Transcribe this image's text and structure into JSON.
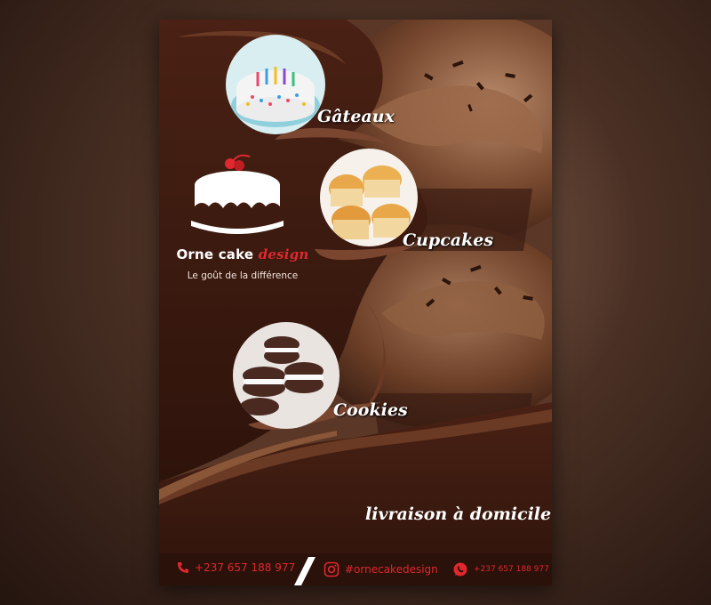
{
  "brand": {
    "name_part1": "Orne cake",
    "name_part2": "design",
    "tagline": "Le goût de la différence"
  },
  "sections": [
    {
      "label": "Gâteaux",
      "icon": "birthday-cake-photo"
    },
    {
      "label": "Cupcakes",
      "icon": "cupcakes-photo"
    },
    {
      "label": "Cookies",
      "icon": "cookies-photo"
    }
  ],
  "delivery": "livraison à domicile",
  "footer": {
    "phone1": "+237 657 188 977",
    "instagram": "#ornecakedesign",
    "whatsapp": "+237 657 188 977"
  },
  "colors": {
    "background_brown": "#3a1c12",
    "accent_red": "#e0282e",
    "chocolate": "#6b3a24"
  },
  "icons": [
    "cake-logo-icon",
    "phone-icon",
    "instagram-icon",
    "whatsapp-icon"
  ]
}
